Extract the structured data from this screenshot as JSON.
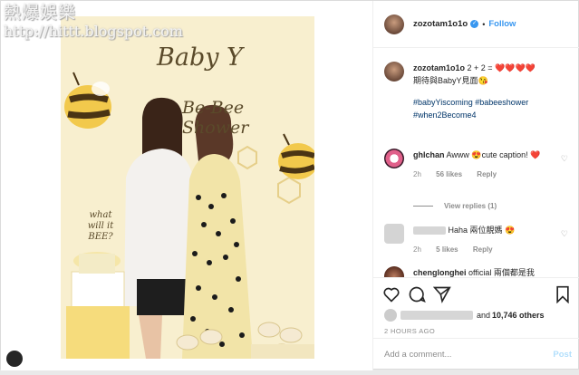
{
  "watermark": {
    "title": "熱爆娛樂",
    "url": "http://hittt.blogspot.com"
  },
  "photo": {
    "sign_title": "Baby Y",
    "sign_subtitle": "Be-Bee Shower",
    "cake_topper": "what will it BEE?"
  },
  "header": {
    "username": "zozotam1o1o",
    "separator": "•",
    "follow_label": "Follow"
  },
  "caption": {
    "username": "zozotam1o1o",
    "text_line1": "2 + 2 = ❤️❤️❤️❤️",
    "text_line2": "期待與BabyY見面😘",
    "hashtags_line1": "#babyYiscoming #babeeshower",
    "hashtags_line2": "#when2Become4"
  },
  "comments": [
    {
      "username": "ghlchan",
      "text": "Awww 😍cute caption! ❤️",
      "time": "2h",
      "likes": "56 likes",
      "reply": "Reply",
      "view_replies": "View replies (1)"
    },
    {
      "username": "",
      "text": "Haha 兩位靚媽 😍",
      "time": "2h",
      "likes": "5 likes",
      "reply": "Reply"
    },
    {
      "username": "chenglonghei",
      "text": "official 兩個都是我"
    }
  ],
  "likes": {
    "prefix": "and",
    "count": "10,746 others"
  },
  "timeago": "2 HOURS AGO",
  "add_comment": {
    "placeholder": "Add a comment...",
    "post_label": "Post"
  },
  "colors": {
    "accent": "#3897f0",
    "hashtag": "#003569",
    "muted": "#8e8e8e"
  }
}
